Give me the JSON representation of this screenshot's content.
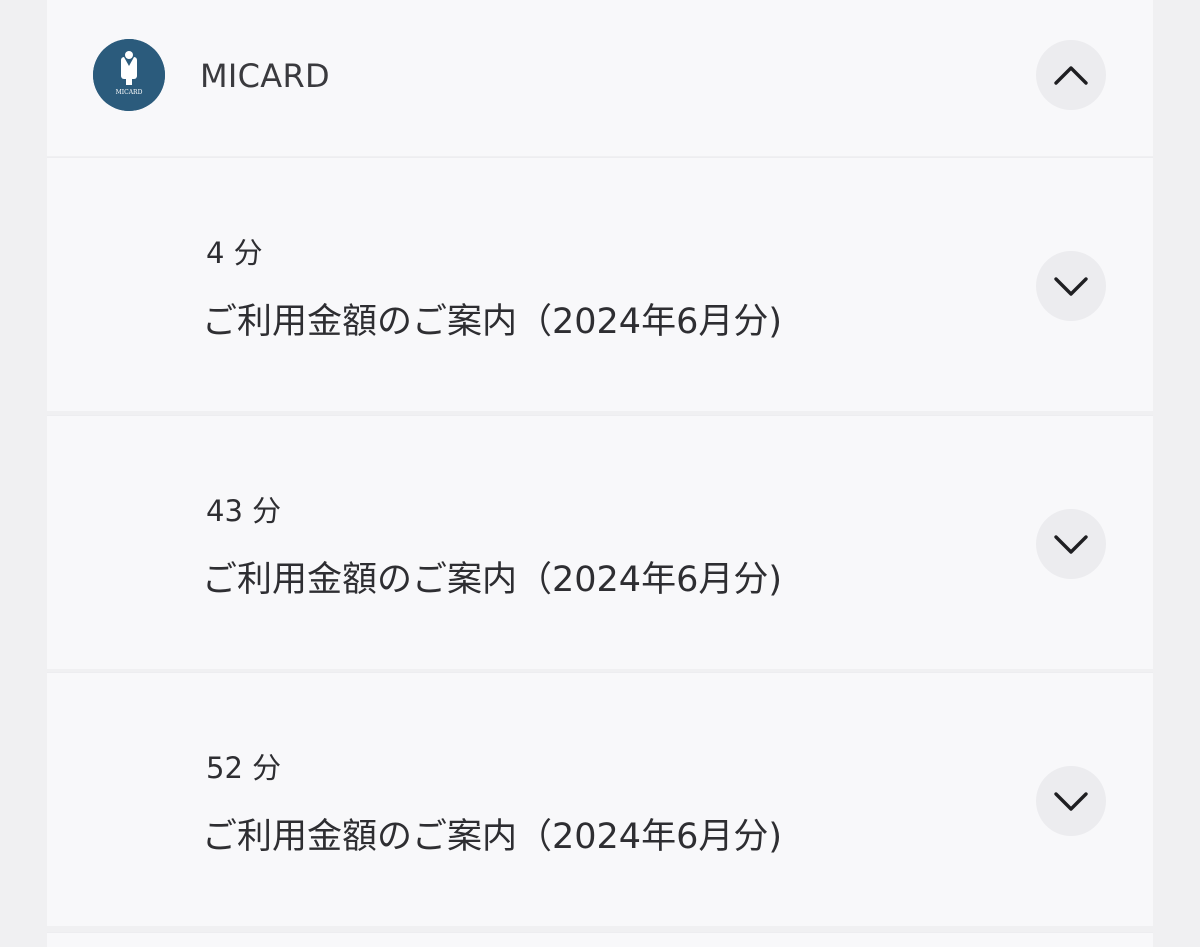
{
  "thread": {
    "sender": "MICARD",
    "avatar_text": "MICARD",
    "collapse_icon": "chevron-up-icon",
    "messages": [
      {
        "time": "4 分",
        "subject": "ご利用金額のご案内（2024年6月分)",
        "expand_icon": "chevron-down-icon"
      },
      {
        "time": "43 分",
        "subject": "ご利用金額のご案内（2024年6月分)",
        "expand_icon": "chevron-down-icon"
      },
      {
        "time": "52 分",
        "subject": "ご利用金額のご案内（2024年6月分)",
        "expand_icon": "chevron-down-icon"
      }
    ]
  },
  "colors": {
    "background": "#f0f0f2",
    "panel": "#f8f8fa",
    "avatar": "#2b5b7c",
    "button": "#ececef",
    "text": "#2e2e32"
  }
}
